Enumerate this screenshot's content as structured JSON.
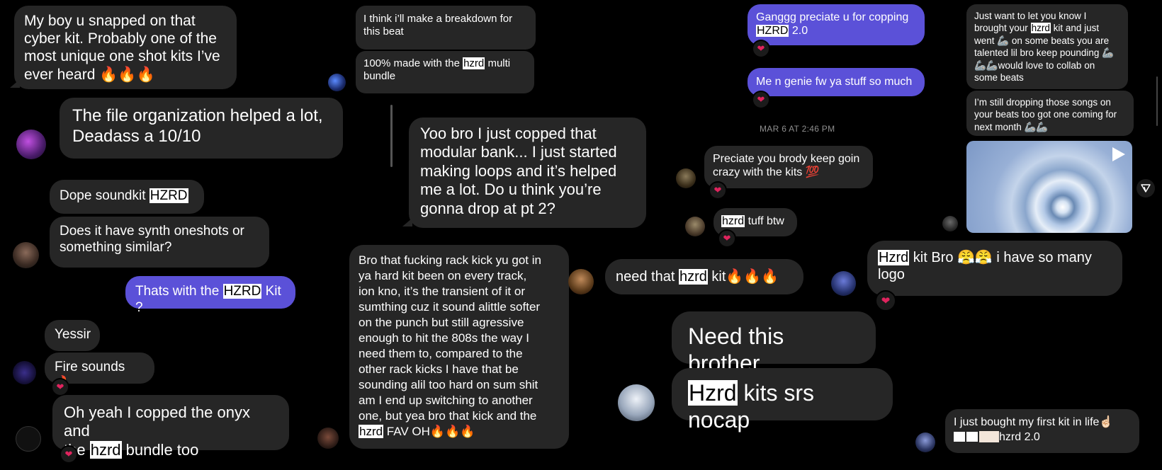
{
  "messages": {
    "m1": {
      "lines": [
        "My boy u snapped on that",
        "cyber kit. Probably one of the",
        "most unique one shot kits I’ve",
        "ever heard 🔥🔥🔥"
      ]
    },
    "m2": {
      "lines": [
        "The file organization helped a lot,",
        "Deadass a 10/10"
      ]
    },
    "m3": {
      "pre": "Dope soundkit ",
      "hl": "HZRD"
    },
    "m4": {
      "lines": [
        "Does it have synth oneshots or",
        "something similar?"
      ]
    },
    "m5": {
      "pre": "Thats with the ",
      "hl": "HZRD",
      "post": " Kit ?"
    },
    "m6": {
      "text": "Yessir"
    },
    "m7": {
      "text": "Fire sounds 🔥"
    },
    "m8": {
      "line1": "Oh yeah I copped the onyx and",
      "pre": "the ",
      "hl": "hzrd",
      "post": " bundle too"
    },
    "m9": {
      "lines": [
        "I think i’ll make a breakdown for",
        "this beat"
      ]
    },
    "m10": {
      "pre": "100% made with the ",
      "hl": "hzrd",
      "post": " multi",
      "line2": "bundle"
    },
    "m11": {
      "lines": [
        "Yoo bro I just copped that",
        "modular bank... I just started",
        "making loops and it’s helped",
        "me a lot. Do u think you’re",
        "gonna drop at pt 2?"
      ]
    },
    "m12": {
      "lines": [
        "Bro that fucking rack kick yu got in",
        "ya hard kit been on every track,",
        "ion kno, it’s the transient of it or",
        "sumthing cuz it sound alittle softer",
        "on the punch but still agressive",
        "enough to hit the 808s the way I",
        "need them to, compared to the",
        "other rack kicks I have that be",
        "sounding alil too hard on sum shit",
        "am I end up switching to another",
        "one, but yea bro that kick and the"
      ],
      "hl": "hzrd",
      "post": " FAV OH🔥🔥🔥"
    },
    "m13": {
      "lines": [
        "Ganggg preciate u for copping"
      ],
      "hl": "HZRD",
      "post": " 2.0"
    },
    "m14": {
      "text": "Me n genie fw ya stuff so much"
    },
    "timestamp": "MAR 6 AT 2:46 PM",
    "m15": {
      "lines": [
        "Preciate you brody keep goin",
        "crazy with the kits 💯"
      ]
    },
    "m16": {
      "hl": "hzrd",
      "post": " tuff btw"
    },
    "m17": {
      "pre": "need that ",
      "hl": "hzrd",
      "post": " kit🔥🔥🔥"
    },
    "m18": {
      "text": "Need this brother"
    },
    "m19": {
      "hl": "Hzrd",
      "post": " kits srs nocap"
    },
    "m20": {
      "line1": "Just want to let you know I",
      "pre": "brought your ",
      "hl": "hzrd",
      "post": " kit and just",
      "rest": [
        "went 🦾 on some beats you are",
        "talented lil bro keep pounding 🦾",
        "🦾🦾would love to collab on",
        "some beats"
      ]
    },
    "m21": {
      "lines": [
        "I’m still dropping those songs on",
        "your beats too got one coming for",
        "next month 🦾🦾"
      ]
    },
    "m22": {
      "hl": "Hzrd",
      "post": " kit Bro 😤😤 i have so many",
      "line2": "logo"
    },
    "m23": {
      "line1": "I just bought my first kit in life☝🏻",
      "post": "hzrd 2.0"
    }
  },
  "reaction": "❤",
  "icons": {
    "play": "play-icon",
    "send": "send-icon"
  },
  "colors": {
    "bubble": "#262626",
    "sent": "#5b51d8",
    "highlight": "#ffffff",
    "heart": "#e0245e"
  }
}
